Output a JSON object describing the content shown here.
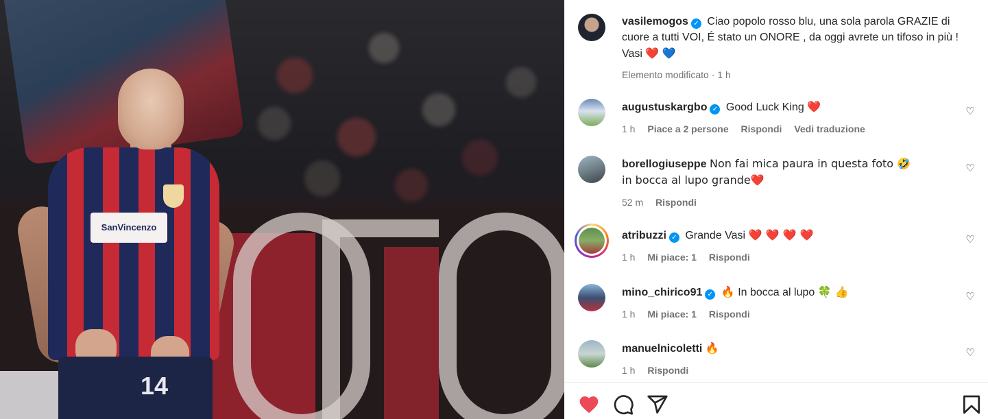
{
  "post": {
    "author": "vasilemogos",
    "caption": "Ciao popolo rosso blu, una sola parola GRAZIE di cuore a tutti VOI, É stato un ONORE , da oggi avrete un tifoso in più ! Vasi",
    "caption_emojis": [
      "❤️",
      "💙"
    ],
    "edited_label": "Elemento modificato",
    "time": "1 h"
  },
  "photo": {
    "shirt_sponsor": "SanVincenzo",
    "shirt_number": "14"
  },
  "comments": [
    {
      "username": "augustuskargbo",
      "verified": true,
      "text": "Good Luck King",
      "emoji": "❤️",
      "time": "1 h",
      "likes": "Piace a 2 persone",
      "reply": "Rispondi",
      "translate": "Vedi traduzione"
    },
    {
      "username": "borellogiuseppe",
      "verified": false,
      "text": "Non fai mica paura in questa foto 🤣 in bocca al lupo grande",
      "emoji": "❤️",
      "time": "52 m",
      "reply": "Rispondi"
    },
    {
      "username": "atribuzzi",
      "verified": true,
      "text": "Grande Vasi",
      "emoji": "❤️ ❤️ ❤️ ❤️",
      "time": "1 h",
      "likes": "Mi piace: 1",
      "reply": "Rispondi"
    },
    {
      "username": "mino_chirico91",
      "verified": true,
      "prefix_emoji": "🔥",
      "text": "In bocca al lupo",
      "emoji": "🍀 👍",
      "time": "1 h",
      "likes": "Mi piace: 1",
      "reply": "Rispondi"
    },
    {
      "username": "manuelnicoletti",
      "verified": false,
      "text": "",
      "emoji": "🔥",
      "time": "1 h",
      "reply": "Rispondi"
    }
  ],
  "icons": {
    "like": "heart-icon",
    "comment": "comment-icon",
    "share": "share-icon",
    "save": "bookmark-icon",
    "comment_like": "heart-outline-icon"
  },
  "colors": {
    "like_active": "#ed4956",
    "verified": "#0095f6",
    "muted_text": "#737373"
  }
}
